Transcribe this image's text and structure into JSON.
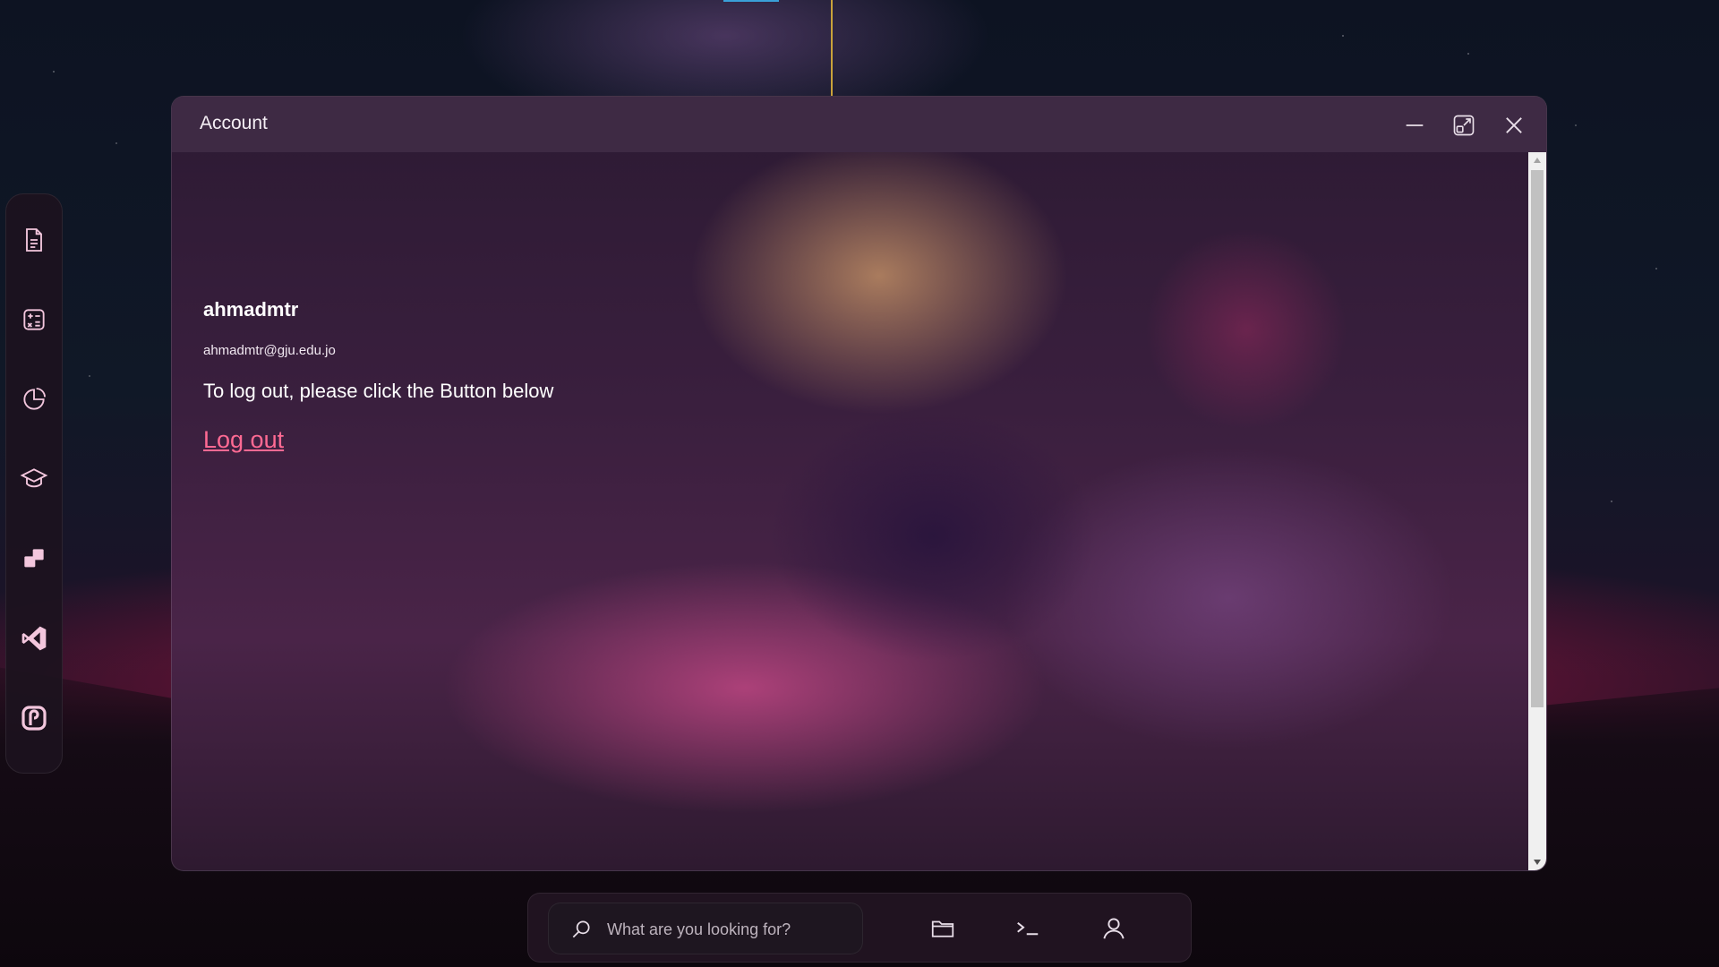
{
  "window": {
    "title": "Account",
    "controls": [
      "minimize-icon",
      "maximize-icon",
      "close-icon"
    ]
  },
  "account": {
    "username": "ahmadmtr",
    "email": "ahmadmtr@gju.edu.jo",
    "message": "To log out, please click the Button below",
    "logout_label": "Log out"
  },
  "dock": {
    "items": [
      {
        "icon": "document-icon"
      },
      {
        "icon": "calculator-icon"
      },
      {
        "icon": "chart-pie-icon"
      },
      {
        "icon": "graduation-cap-icon"
      },
      {
        "icon": "blocks-icon"
      },
      {
        "icon": "vscode-icon"
      },
      {
        "icon": "app-p-icon"
      }
    ]
  },
  "taskbar": {
    "search_placeholder": "What are you looking for?",
    "buttons": [
      "folder-icon",
      "terminal-icon",
      "user-icon"
    ]
  },
  "colors": {
    "accent_link": "#ff6a93",
    "titlebar": "#3e2a44"
  }
}
